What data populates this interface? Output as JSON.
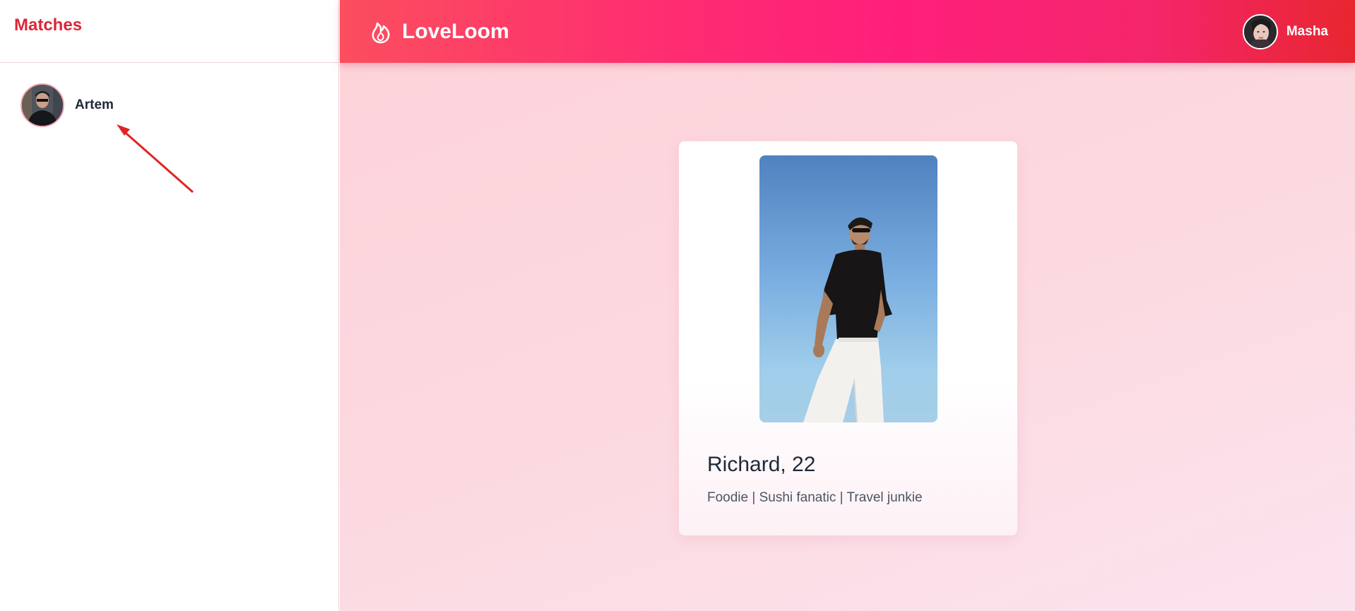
{
  "sidebar": {
    "title": "Matches",
    "matches": [
      {
        "name": "Artem"
      }
    ]
  },
  "header": {
    "brand": "LoveLoom",
    "brand_icon": "flame-icon",
    "user": {
      "name": "Masha"
    }
  },
  "profile_card": {
    "name_age": "Richard, 22",
    "bio": "Foodie | Sushi fanatic | Travel junkie"
  },
  "colors": {
    "accent": "#dc2636",
    "header_gradient_start": "#fb4e5e",
    "header_gradient_mid": "#ff1f7b",
    "header_gradient_end": "#e8262f",
    "background": "#fdd3da"
  }
}
